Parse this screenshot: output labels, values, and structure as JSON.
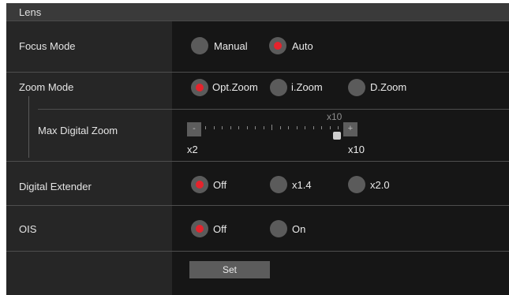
{
  "window": {
    "title": "Lens"
  },
  "focus_mode": {
    "label": "Focus Mode",
    "options": [
      {
        "label": "Manual",
        "selected": false
      },
      {
        "label": "Auto",
        "selected": true
      }
    ]
  },
  "zoom_mode": {
    "label": "Zoom Mode",
    "options": [
      {
        "label": "Opt.Zoom",
        "selected": true
      },
      {
        "label": "i.Zoom",
        "selected": false
      },
      {
        "label": "D.Zoom",
        "selected": false
      }
    ]
  },
  "max_digital_zoom": {
    "label": "Max Digital Zoom",
    "current_value": "x10",
    "min_label": "x2",
    "max_label": "x10",
    "decrement": "-",
    "increment": "+",
    "value": 10,
    "min": 2,
    "max": 10
  },
  "digital_extender": {
    "label": "Digital Extender",
    "options": [
      {
        "label": "Off",
        "selected": true
      },
      {
        "label": "x1.4",
        "selected": false
      },
      {
        "label": "x2.0",
        "selected": false
      }
    ]
  },
  "ois": {
    "label": "OIS",
    "options": [
      {
        "label": "Off",
        "selected": true
      },
      {
        "label": "On",
        "selected": false
      }
    ]
  },
  "actions": {
    "set_label": "Set"
  },
  "colors": {
    "selected_dot": "#e6232c",
    "radio": "#5b5b5b",
    "background": "#161616",
    "label_column": "#262626"
  }
}
